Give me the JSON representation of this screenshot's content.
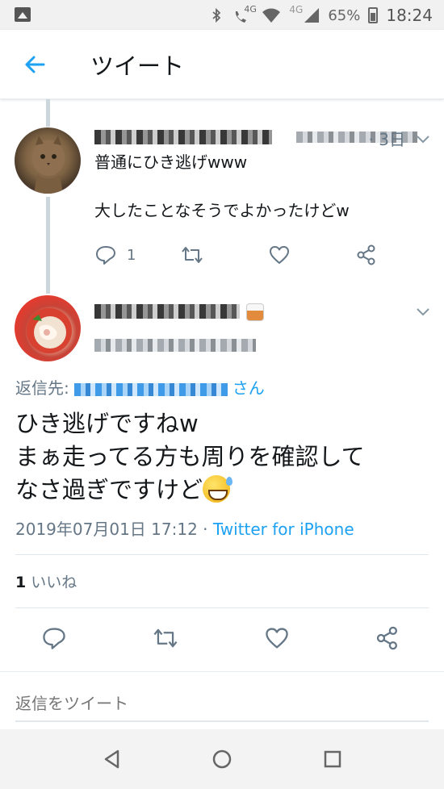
{
  "status_bar": {
    "network_label": "4G",
    "network_label_2": "4G",
    "battery": "65%",
    "time": "18:24"
  },
  "app_bar": {
    "title": "ツイート",
    "back_icon": "arrow-left-icon"
  },
  "parent_tweet": {
    "time": "· 3日",
    "text": "普通にひき逃げwww\n\n大したことなそうでよかったけどw",
    "reply_count": "1"
  },
  "main_tweet": {
    "reply_to_prefix": "返信先:",
    "reply_to_suffix": "さん",
    "text_line1": "ひき逃げですねw",
    "text_line2": "まぁ走ってる方も周りを確認して",
    "text_line3": "なさ過ぎですけど",
    "timestamp": "2019年07月01日 17:12",
    "separator": " · ",
    "source": "Twitter for iPhone",
    "like_count": "1",
    "like_label": "いいね"
  },
  "reply_box": {
    "placeholder": "返信をツイート"
  },
  "colors": {
    "accent": "#1da1f2",
    "muted": "#657786",
    "text": "#14171a",
    "divider": "#e1e8ed"
  },
  "icons": [
    "notification-image-icon",
    "bluetooth-icon",
    "call-icon",
    "wifi-icon",
    "signal-icon",
    "battery-icon",
    "arrow-left-icon",
    "chevron-down-icon",
    "reply-icon",
    "retweet-icon",
    "like-icon",
    "share-icon",
    "nav-back-icon",
    "nav-home-icon",
    "nav-recents-icon"
  ]
}
